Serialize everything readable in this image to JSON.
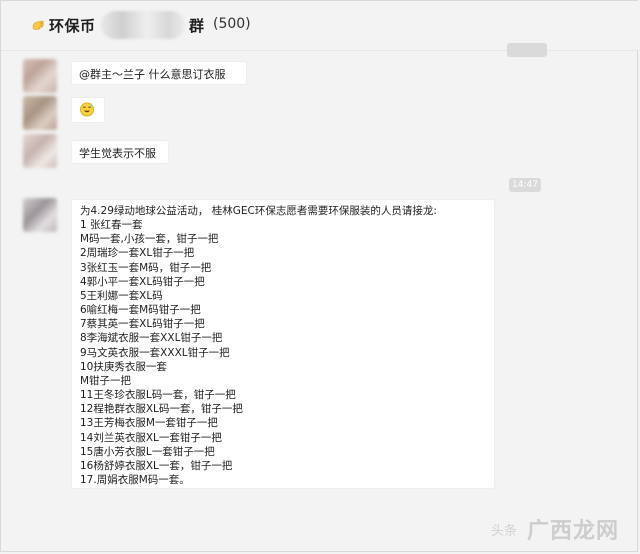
{
  "header": {
    "title_prefix": "环保币",
    "title_suffix": "群",
    "member_count": "(500)"
  },
  "timestamps": [
    "14:47"
  ],
  "messages": [
    {
      "text": "@群主～兰子 什么意思订衣服"
    },
    {
      "emoji": "sweat-smile-emoji"
    },
    {
      "text": "学生觉表示不服"
    }
  ],
  "notice": {
    "lines": [
      "为4.29绿动地球公益活动， 桂林GEC环保志愿者需要环保服装的人员请接龙:",
      "1    张红春一套",
      "M码一套,小孩一套，钳子一把",
      "2周瑞珍一套XL钳子一把",
      "3张红玉一套M码，钳子一把",
      "4郭小平一套XL码钳子一把",
      "5王利娜一套XL码",
      "6喻红梅一套M码钳子一把",
      "7蔡其英一套XL码钳子一把",
      "8李海斌衣服一套XXL钳子一把",
      "9马文英衣服一套XXXL钳子一把",
      "10扶庚秀衣服一套",
      "M钳子一把",
      "11王冬珍衣服L码一套，钳子一把",
      "12程艳群衣服XL码一套，钳子一把",
      "13王芳梅衣服M一套钳子一把",
      "14刘兰英衣服XL一套钳子一把",
      "15唐小芳衣服L一套钳子一把",
      "16杨舒婷衣服XL一套，钳子一把",
      "17.周娟衣服M码一套。"
    ]
  },
  "watermark": {
    "main": "广西龙网",
    "sub": "头条"
  }
}
